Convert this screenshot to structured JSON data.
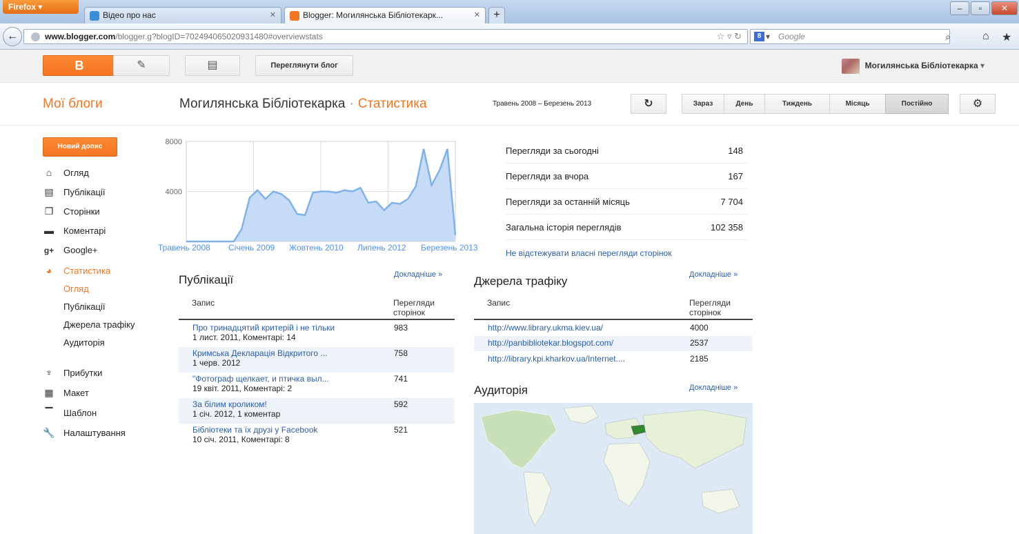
{
  "browser": {
    "app_button": "Firefox",
    "tabs": [
      {
        "label": "Відео про нас",
        "active": false
      },
      {
        "label": "Blogger: Могилянська Бібліотекарк...",
        "active": true
      }
    ],
    "url_domain": "www.blogger.com",
    "url_path": "/blogger.g?blogID=7024940650209314​80#overviewstats",
    "search_placeholder": "Google"
  },
  "blogger_bar": {
    "view_blog_label": "Переглянути блог",
    "user_name": "Могилянська Бібліотекарка"
  },
  "header": {
    "my_blogs": "Мої блоги",
    "blog_name": "Могилянська Бібліотекарка",
    "separator": "·",
    "section": "Статистика",
    "date_range": "Травень 2008 – Березень 2013",
    "refresh_icon": "refresh-icon",
    "periods": [
      "Зараз",
      "День",
      "Тиждень",
      "Місяць",
      "Постійно"
    ],
    "selected_period": "Постійно",
    "settings_icon": "gear-icon"
  },
  "sidebar": {
    "new_post_label": "Новий допис",
    "items": [
      {
        "label": "Огляд",
        "icon": "home-icon"
      },
      {
        "label": "Публікації",
        "icon": "posts-icon"
      },
      {
        "label": "Сторінки",
        "icon": "pages-icon"
      },
      {
        "label": "Коментарі",
        "icon": "comments-icon"
      },
      {
        "label": "Google+",
        "icon": "google-plus-icon"
      },
      {
        "label": "Статистика",
        "icon": "stats-pie-icon"
      }
    ],
    "sub_items": [
      "Огляд",
      "Публікації",
      "Джерела трафіку",
      "Аудиторія"
    ],
    "items_bottom": [
      {
        "label": "Прибутки",
        "icon": "trophy-icon"
      },
      {
        "label": "Макет",
        "icon": "layout-icon"
      },
      {
        "label": "Шаблон",
        "icon": "template-icon"
      },
      {
        "label": "Налаштування",
        "icon": "wrench-icon"
      }
    ]
  },
  "chart_data": {
    "type": "area",
    "x_tick_labels": [
      "Травень 2008",
      "Січень 2009",
      "Жовтень 2010",
      "Липень 2012",
      "Березень 2013"
    ],
    "y_tick_labels": [
      "8000",
      "4000"
    ],
    "ylim": [
      0,
      8000
    ],
    "values": [
      0,
      0,
      0,
      0,
      0,
      0,
      0,
      1000,
      3500,
      4100,
      3400,
      4000,
      3800,
      3300,
      2200,
      2100,
      3900,
      4000,
      4000,
      3900,
      4100,
      4000,
      4300,
      3100,
      3200,
      2500,
      3100,
      3000,
      3400,
      4400,
      7400,
      4500,
      5700,
      7400,
      500
    ],
    "color": "#7fb2ea",
    "fill": "#c6dcf6",
    "grid": true
  },
  "stats": [
    {
      "label": "Перегляди за сьогодні",
      "value": "148"
    },
    {
      "label": "Перегляди за вчора",
      "value": "167"
    },
    {
      "label": "Перегляди за останній місяць",
      "value": "7 704"
    },
    {
      "label": "Загальна історія переглядів",
      "value": "102 358"
    }
  ],
  "no_track_link": "Не відстежувати власні перегляди сторінок",
  "posts": {
    "title": "Публікації",
    "more": "Докладніше »",
    "col_entry": "Запис",
    "col_views": "Перегляди сторінок",
    "rows": [
      {
        "title": "Про тринадцятий критерій і не тільки",
        "meta": "1 лист. 2011, Коментарі: 14",
        "views": "983"
      },
      {
        "title": "Кримська Декларація Відкритого ...",
        "meta": "1 черв. 2012",
        "views": "758"
      },
      {
        "title": "\"Фотограф щелкает, и птичка выл...",
        "meta": "19 квіт. 2011, Коментарі: 2",
        "views": "741"
      },
      {
        "title": "За білим кроликом!",
        "meta": "1 січ. 2012, 1 коментар",
        "views": "592"
      },
      {
        "title": "Бібліотеки та їх друзі у Facebook",
        "meta": "10 січ. 2011, Коментарі: 8",
        "views": "521"
      }
    ]
  },
  "traffic": {
    "title": "Джерела трафіку",
    "more": "Докладніше »",
    "col_entry": "Запис",
    "col_views": "Перегляди сторінок",
    "rows": [
      {
        "url": "http://www.library.ukma.kiev.ua/",
        "views": "4000"
      },
      {
        "url": "http://panbibliotekar.blogspot.com/",
        "views": "2537"
      },
      {
        "url": "http://library.kpi.kharkov.ua/Internet....",
        "views": "2185"
      }
    ]
  },
  "audience": {
    "title": "Аудиторія",
    "more": "Докладніше »"
  }
}
